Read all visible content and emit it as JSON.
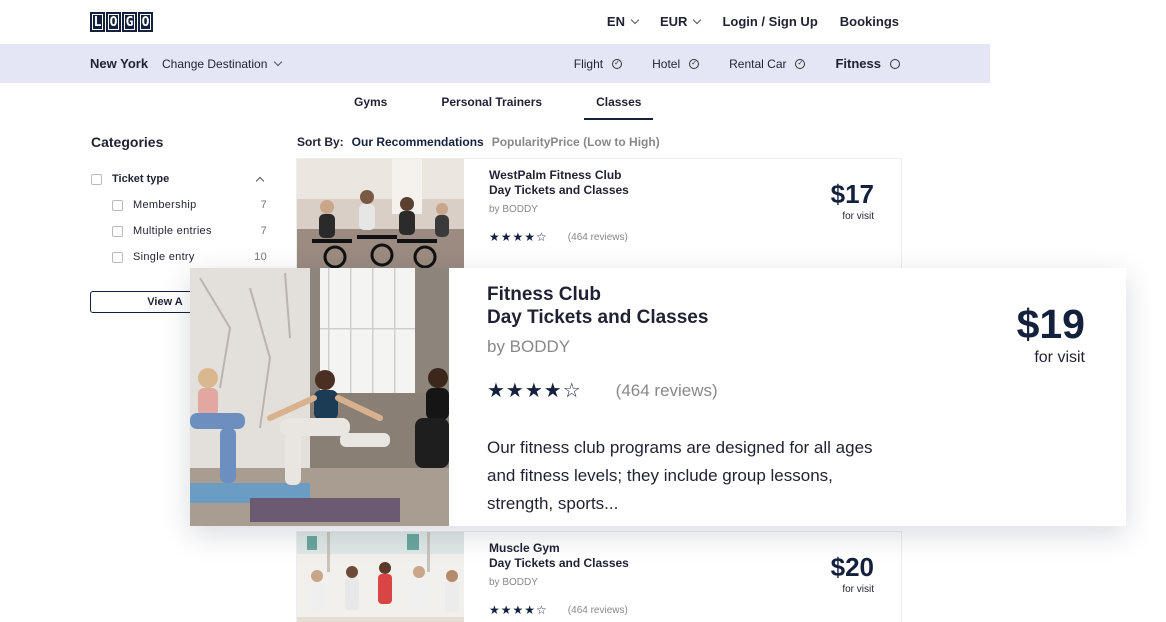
{
  "logo": {
    "letters": [
      "L",
      "O",
      "G",
      "O"
    ]
  },
  "top_nav": {
    "language": "EN",
    "currency": "EUR",
    "login": "Login / Sign Up",
    "bookings": "Bookings"
  },
  "subbar": {
    "city": "New York",
    "change_destination": "Change Destination",
    "modes": [
      {
        "label": "Flight",
        "icon": "check-circle-icon"
      },
      {
        "label": "Hotel",
        "icon": "check-circle-icon"
      },
      {
        "label": "Rental Car",
        "icon": "check-circle-icon"
      },
      {
        "label": "Fitness",
        "icon": "empty-circle-icon"
      }
    ]
  },
  "tabs": [
    {
      "label": "Gyms"
    },
    {
      "label": "Personal Trainers"
    },
    {
      "label": "Classes"
    }
  ],
  "sidebar": {
    "title": "Categories",
    "group": {
      "label": "Ticket type",
      "options": [
        {
          "label": "Membership",
          "count": "7"
        },
        {
          "label": "Multiple entries",
          "count": "7"
        },
        {
          "label": "Single entry",
          "count": "10"
        }
      ]
    },
    "view_button": "View A"
  },
  "sort": {
    "label": "Sort By:",
    "active": "Our Recommendations",
    "others": "PopularityPrice (Low to High)"
  },
  "listings": [
    {
      "name_line1": "WestPalm Fitness Club",
      "name_line2": "Day Tickets and Classes",
      "by": "by BODDY",
      "stars": "★★★★☆",
      "reviews": "(464 reviews)",
      "price": "$17",
      "per": "for visit"
    },
    {
      "name_line1": "Muscle Gym",
      "name_line2": "Day Tickets and Classes",
      "by": "by BODDY",
      "stars": "★★★★☆",
      "reviews": "(464 reviews)",
      "price": "$20",
      "per": "for visit"
    }
  ],
  "featured": {
    "name_line1": "Fitness Club",
    "name_line2": "Day Tickets and Classes",
    "by": "by BODDY",
    "stars": "★★★★☆",
    "reviews": "(464 reviews)",
    "description": "Our fitness club programs are designed for all ages and fitness levels; they include group lessons, strength, sports...",
    "price": "$19",
    "per": "for visit"
  },
  "colors": {
    "brand_navy": "#14213d",
    "subbar_bg": "#e4e5f5",
    "muted_text": "#888888"
  }
}
